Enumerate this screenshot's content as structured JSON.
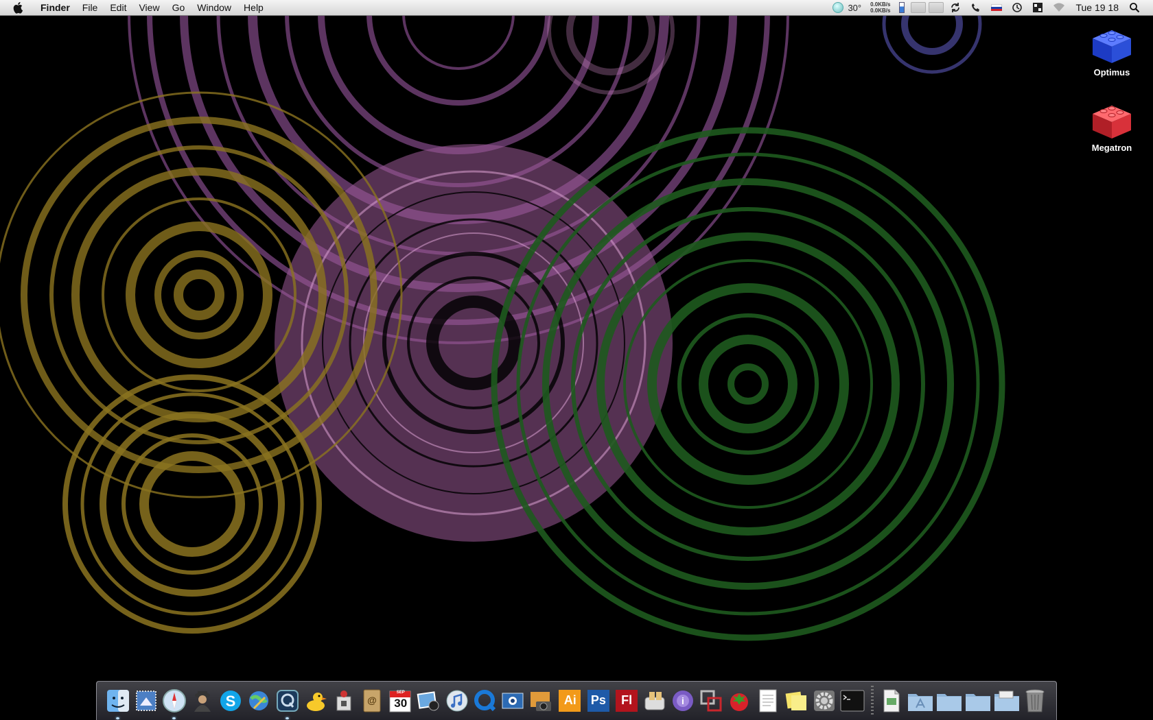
{
  "menubar": {
    "app_name": "Finder",
    "menus": [
      "File",
      "Edit",
      "View",
      "Go",
      "Window",
      "Help"
    ],
    "temperature": "30°",
    "net_up": "0.0KB/s",
    "net_down": "0.0KB/s",
    "clock": "Tue 19 18"
  },
  "desktop": {
    "icons": [
      {
        "label": "Optimus",
        "color": "#2b4fd8"
      },
      {
        "label": "Megatron",
        "color": "#d8313a"
      }
    ]
  },
  "dock": {
    "calendar_month": "SEP",
    "calendar_day": "30",
    "illustrator_label": "Ai",
    "photoshop_label": "Ps",
    "flash_label": "Fl"
  },
  "colors": {
    "wallpaper": "#000000",
    "ring_purple": "#a85fb0",
    "ring_gold": "#8b7420",
    "ring_green": "#1e5a1e"
  }
}
